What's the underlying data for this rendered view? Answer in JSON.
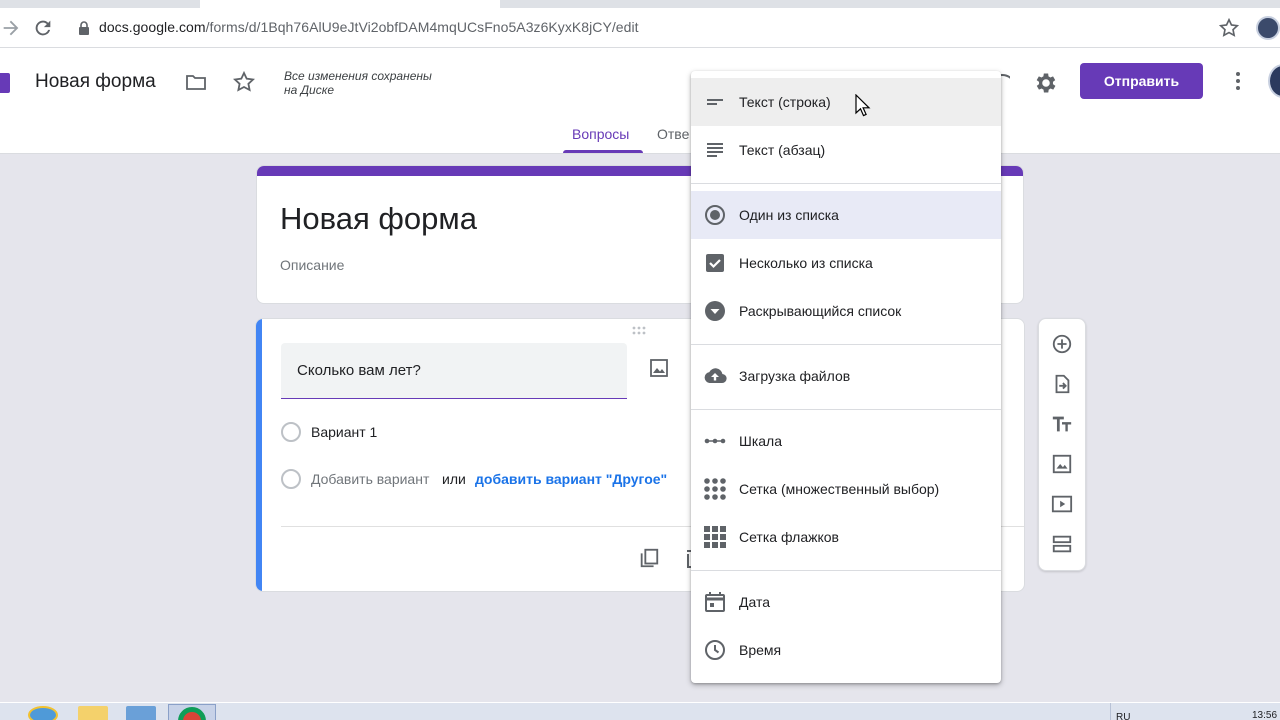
{
  "browser": {
    "url_host": "docs.google.com",
    "url_path": "/forms/d/1Bqh76AlU9eJtVi2obfDAM4mqUCsFno5A3z6KyxK8jCY/edit"
  },
  "header": {
    "doc_title": "Новая форма",
    "save_status_line1": "Все изменения сохранены",
    "save_status_line2": "на Диске",
    "send_label": "Отправить",
    "tabs": [
      {
        "label": "Вопросы"
      },
      {
        "label": "Отве"
      }
    ]
  },
  "form": {
    "title": "Новая форма",
    "description_placeholder": "Описание"
  },
  "question": {
    "title": "Сколько вам лет?",
    "option_1": "Вариант 1",
    "add_option": "Добавить вариант",
    "or": "или",
    "add_other": "добавить вариант \"Другое\""
  },
  "menu": {
    "items": [
      {
        "label": "Текст (строка)",
        "icon": "short-text-icon",
        "state": "hover"
      },
      {
        "label": "Текст (абзац)",
        "icon": "paragraph-icon"
      },
      {
        "label": "Один из списка",
        "icon": "radio-button-icon",
        "state": "selected"
      },
      {
        "label": "Несколько из списка",
        "icon": "checkbox-icon"
      },
      {
        "label": "Раскрывающийся список",
        "icon": "dropdown-icon"
      },
      {
        "label": "Загрузка файлов",
        "icon": "cloud-upload-icon"
      },
      {
        "label": "Шкала",
        "icon": "linear-scale-icon"
      },
      {
        "label": "Сетка (множественный выбор)",
        "icon": "grid-dots-icon"
      },
      {
        "label": "Сетка флажков",
        "icon": "grid-checkbox-icon"
      },
      {
        "label": "Дата",
        "icon": "calendar-icon"
      },
      {
        "label": "Время",
        "icon": "clock-icon"
      }
    ]
  },
  "sidebar_tools": [
    "add-question-icon",
    "import-questions-icon",
    "add-title-icon",
    "add-image-icon",
    "add-video-icon",
    "add-section-icon"
  ],
  "taskbar": {
    "lang": "RU",
    "time": "13:56"
  },
  "colors": {
    "accent": "#673ab7",
    "question_bar": "#4285f4",
    "link": "#1a73e8",
    "page_bg": "#e5e5ec"
  }
}
